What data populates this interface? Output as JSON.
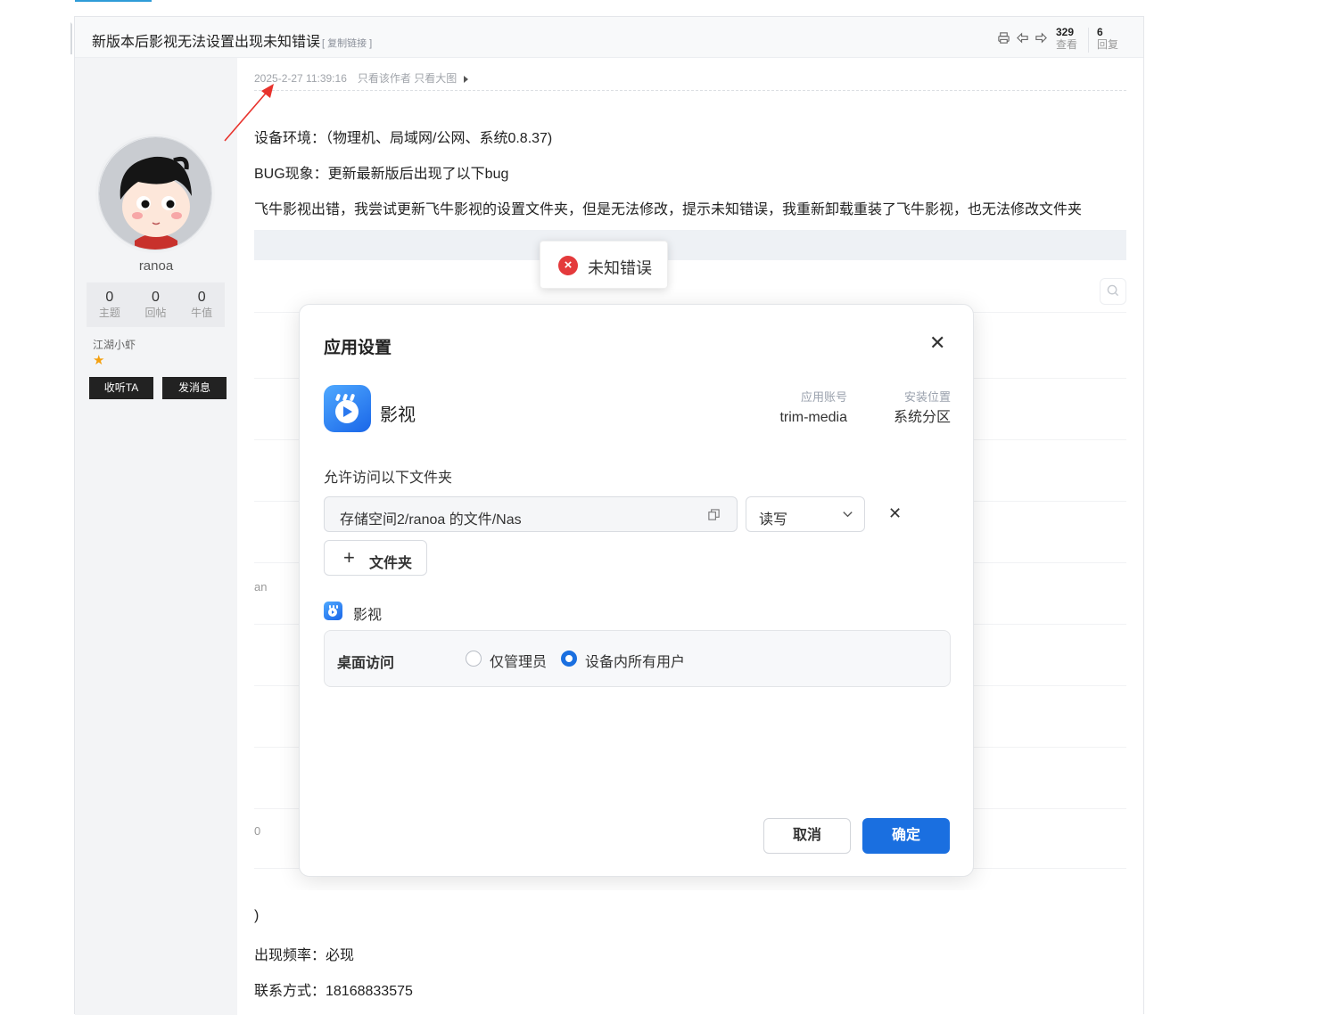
{
  "post": {
    "title": "新版本后影视无法设置出现未知错误",
    "copy_link": "[ 复制链接 ]",
    "views": "329",
    "views_label": "查看",
    "replies": "6",
    "replies_label": "回复",
    "timestamp": "2025-2-27 11:39:16",
    "only_author": "只看该作者",
    "only_images": "只看大图",
    "lines": [
      "设备环境：（物理机、局域网/公网、系统0.8.37)",
      "BUG现象：更新最新版后出现了以下bug",
      "飞牛影视出错，我尝试更新飞牛影视的设置文件夹，但是无法修改，提示未知错误，我重新卸载重装了飞牛影视，也无法修改文件夹"
    ],
    "after_lines": [
      ")",
      "出现频率：必现",
      "联系方式：18168833575"
    ]
  },
  "author": {
    "username": "ranoa",
    "stats": [
      {
        "value": "0",
        "label": "主题"
      },
      {
        "value": "0",
        "label": "回帖"
      },
      {
        "value": "0",
        "label": "牛值"
      }
    ],
    "rank": "江湖小虾",
    "follow_button": "收听TA",
    "message_button": "发消息"
  },
  "screenshot": {
    "toast": "未知错误",
    "left_fragment_1": "an",
    "left_fragment_2": "0",
    "dialog": {
      "title": "应用设置",
      "app_name": "影视",
      "account_label": "应用账号",
      "account_value": "trim-media",
      "location_label": "安装位置",
      "location_value": "系统分区",
      "folders_label": "允许访问以下文件夹",
      "folder_path": "存储空间2/ranoa 的文件/Nas",
      "permission": "读写",
      "add_folder": "文件夹",
      "section_app": "影视",
      "desktop_access_label": "桌面访问",
      "option_admin": "仅管理员",
      "option_all": "设备内所有用户",
      "selected_option": "设备内所有用户",
      "cancel": "取消",
      "confirm": "确定"
    }
  },
  "colors": {
    "accent_blue": "#1a6fe0",
    "error_red": "#e43a3c",
    "annotation_arrow": "#e8322c"
  }
}
